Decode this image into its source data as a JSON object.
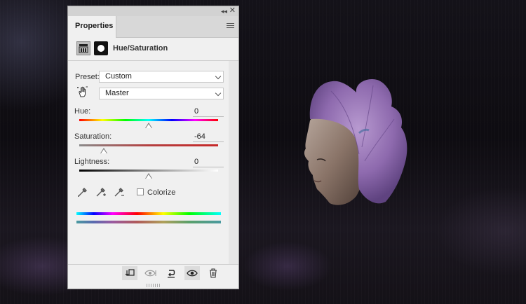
{
  "panel": {
    "tab_label": "Properties",
    "adjustment_title": "Hue/Saturation",
    "preset": {
      "label": "Preset:",
      "value": "Custom"
    },
    "channel": {
      "value": "Master"
    },
    "hue": {
      "label": "Hue:",
      "value": "0"
    },
    "saturation": {
      "label": "Saturation:",
      "value": "-64"
    },
    "lightness": {
      "label": "Lightness:",
      "value": "0"
    },
    "colorize": {
      "label": "Colorize",
      "checked": false
    },
    "icons": {
      "collapse": "double-chevron-icon",
      "close": "close-icon",
      "menu": "panel-menu-icon",
      "adjustment": "hue-saturation-adjustment-icon",
      "mask": "layer-mask-icon",
      "targeted_adjustment": "targeted-adjustment-hand-icon",
      "eyedropper": "eyedropper-icon",
      "eyedropper_add": "eyedropper-add-icon",
      "eyedropper_subtract": "eyedropper-subtract-icon",
      "clip": "clip-to-layer-icon",
      "view_previous": "view-previous-state-icon",
      "reset": "reset-icon",
      "visibility": "visibility-eye-icon",
      "delete": "trash-icon"
    },
    "colors": {
      "panel_bg": "#f0f0f0",
      "saturation_track": "#c62828"
    }
  }
}
